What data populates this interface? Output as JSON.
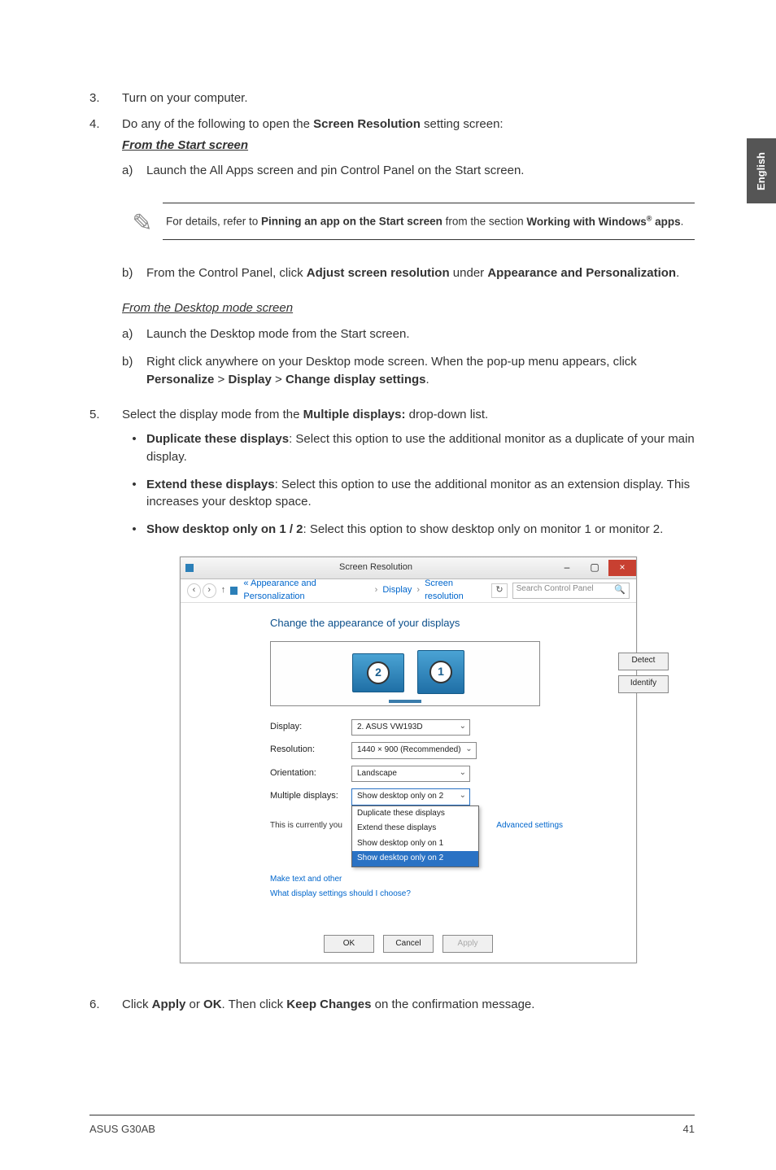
{
  "sidetab": "English",
  "steps": {
    "s3": {
      "num": "3.",
      "text": "Turn on your computer."
    },
    "s4": {
      "num": "4.",
      "lead_pre": "Do any of the following to open the ",
      "lead_bold": "Screen Resolution",
      "lead_post": " setting screen:",
      "from_start": "From the Start screen",
      "a_label": "a)",
      "a_text": "Launch the All Apps screen and pin Control Panel on the Start screen.",
      "note": {
        "pre": "For details, refer to ",
        "b1": "Pinning an app on the Start screen",
        "mid": " from the section ",
        "b2_pre": "Working with Windows",
        "b2_sup": "®",
        "b2_post": " apps",
        "end": "."
      },
      "b_label": "b)",
      "b_pre": "From the Control Panel, click ",
      "b_bold1": "Adjust screen resolution",
      "b_mid": " under ",
      "b_bold2": "Appearance and Personalization",
      "b_end": ".",
      "from_desktop": "From the Desktop mode screen",
      "da_label": "a)",
      "da_text": "Launch the Desktop mode from the Start screen.",
      "db_label": "b)",
      "db_pre": "Right click anywhere on your Desktop mode screen. When the pop-up menu appears, click ",
      "db_b1": "Personalize",
      "db_g1": " > ",
      "db_b2": "Display",
      "db_g2": " > ",
      "db_b3": "Change display settings",
      "db_end": "."
    },
    "s5": {
      "num": "5.",
      "pre": "Select the display mode from the ",
      "bold": "Multiple displays:",
      "post": " drop-down list.",
      "bullets": [
        {
          "b": "Duplicate these displays",
          "t": ": Select this option to use the additional monitor as a duplicate of your main display."
        },
        {
          "b": "Extend these displays",
          "t": ": Select this option to use the additional monitor as an extension display. This increases your desktop space."
        },
        {
          "b": "Show desktop only on 1 / 2",
          "t": ": Select this option to show desktop only on monitor 1 or monitor 2."
        }
      ]
    },
    "s6": {
      "num": "6.",
      "pre": "Click ",
      "b1": "Apply",
      "mid1": " or ",
      "b2": "OK",
      "mid2": ". Then click ",
      "b3": "Keep Changes",
      "post": " on the confirmation message."
    }
  },
  "shot": {
    "title": "Screen Resolution",
    "min": "–",
    "max": "▢",
    "close": "×",
    "crumb1": "« Appearance and Personalization",
    "crumb2": "Display",
    "crumb3": "Screen resolution",
    "refresh": "↻",
    "search_ph": "Search Control Panel",
    "search_icon": "🔍",
    "heading": "Change the appearance of your displays",
    "mon1": "1",
    "mon2": "2",
    "detect": "Detect",
    "identify": "Identify",
    "rows": {
      "display_lbl": "Display:",
      "display_val": "2. ASUS VW193D",
      "res_lbl": "Resolution:",
      "res_val": "1440 × 900 (Recommended)",
      "orient_lbl": "Orientation:",
      "orient_val": "Landscape",
      "mult_lbl": "Multiple displays:",
      "mult_val": "Show desktop only on 2"
    },
    "drop": {
      "o1": "Duplicate these displays",
      "o2": "Extend these displays",
      "o3": "Show desktop only on 1",
      "o4": "Show desktop only on 2"
    },
    "currently_pre": "This is currently you",
    "make_text_pre": "Make text and other",
    "adv": "Advanced settings",
    "whatlink": "What display settings should I choose?",
    "ok": "OK",
    "cancel": "Cancel",
    "apply": "Apply"
  },
  "footer": {
    "left": "ASUS G30AB",
    "right": "41"
  }
}
